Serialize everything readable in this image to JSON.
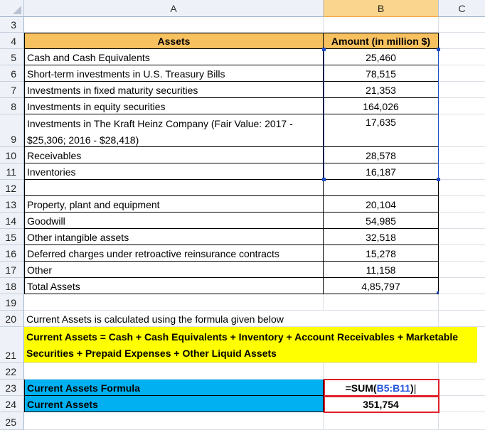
{
  "columns": [
    "A",
    "B",
    "C"
  ],
  "rows": [
    {
      "n": "3",
      "a": "",
      "b": ""
    },
    {
      "n": "4",
      "a": "Assets",
      "b": "Amount (in million $)"
    },
    {
      "n": "5",
      "a": "Cash and Cash Equivalents",
      "b": "25,460"
    },
    {
      "n": "6",
      "a": "Short-term investments in U.S. Treasury Bills",
      "b": "78,515"
    },
    {
      "n": "7",
      "a": "Investments in fixed maturity securities",
      "b": "21,353"
    },
    {
      "n": "8",
      "a": "Investments in equity securities",
      "b": "164,026"
    },
    {
      "n": "9",
      "a": "Investments in The Kraft Heinz Company (Fair Value: 2017 - $25,306; 2016 - $28,418)",
      "b": "17,635"
    },
    {
      "n": "10",
      "a": "Receivables",
      "b": "28,578"
    },
    {
      "n": "11",
      "a": "Inventories",
      "b": "16,187"
    },
    {
      "n": "12",
      "a": "",
      "b": ""
    },
    {
      "n": "13",
      "a": "Property, plant and equipment",
      "b": "20,104"
    },
    {
      "n": "14",
      "a": "Goodwill",
      "b": "54,985"
    },
    {
      "n": "15",
      "a": "Other intangible assets",
      "b": "32,518"
    },
    {
      "n": "16",
      "a": "Deferred charges under retroactive reinsurance contracts",
      "b": "15,278"
    },
    {
      "n": "17",
      "a": "Other",
      "b": "11,158"
    },
    {
      "n": "18",
      "a": "Total Assets",
      "b": "4,85,797"
    },
    {
      "n": "19",
      "a": "",
      "b": ""
    },
    {
      "n": "20",
      "a": "Current Assets is calculated using the formula given below",
      "b": ""
    },
    {
      "n": "21",
      "a": "Current Assets = Cash + Cash Equivalents + Inventory + Account Receivables + Marketable Securities + Prepaid Expenses + Other Liquid Assets",
      "b": ""
    },
    {
      "n": "22",
      "a": "",
      "b": ""
    },
    {
      "n": "23",
      "a": "Current Assets Formula",
      "b": ""
    },
    {
      "n": "24",
      "a": "Current Assets",
      "b": "351,754"
    },
    {
      "n": "25",
      "a": "",
      "b": ""
    }
  ],
  "formula": {
    "prefix": "=SUM(",
    "range": "B5:B11",
    "suffix": ")"
  },
  "colors": {
    "header_fill": "#f7c15f",
    "yellow": "#ffff00",
    "blue": "#00b0f0",
    "red_border": "#e0202a"
  }
}
